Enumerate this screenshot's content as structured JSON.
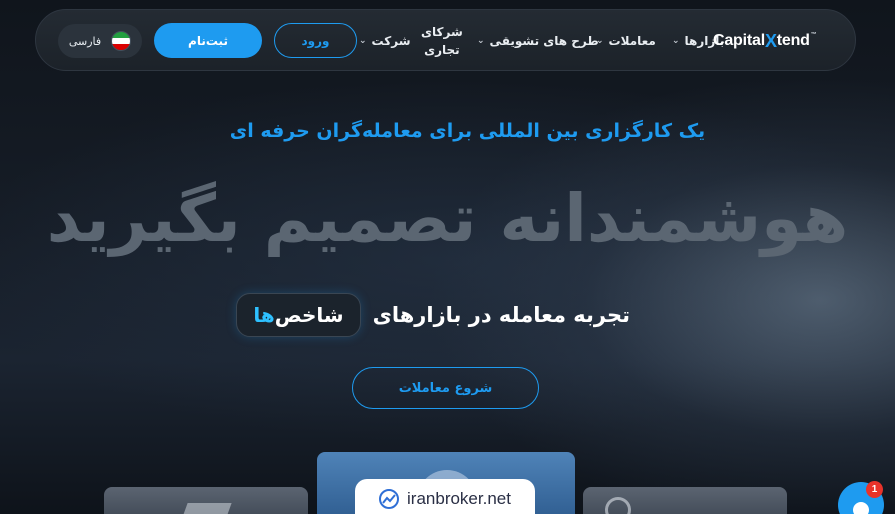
{
  "nav": {
    "logo": {
      "part1": "Capital",
      "x": "X",
      "part2": "tend",
      "tm": "™"
    },
    "items": [
      {
        "label": "بازارها"
      },
      {
        "label": "معاملات"
      },
      {
        "label": "طرح های تشویقی"
      },
      {
        "label": "شرکت"
      },
      {
        "label_line1": "شرکای",
        "label_line2": "تجاری"
      }
    ],
    "login_label": "ورود",
    "signup_label": "ثبت‌نام",
    "language_label": "فارسی",
    "chevron": "⌄"
  },
  "hero": {
    "subtitle": "یک کارگزاری بین المللی برای معامله‌گران حرفه ای",
    "headline": "هوشمندانه تصمیم بگیرید",
    "tagline_text": "تجربه معامله در بازارهای",
    "tagline_chip_plain": "شاخص",
    "tagline_chip_highlight": "‌ها",
    "start_button": "شروع معاملات"
  },
  "watermark": {
    "text": "iranbroker.net"
  },
  "chat": {
    "badge_count": "1"
  },
  "colors": {
    "accent": "#1e9bf0",
    "headline": "#5b6672",
    "badge": "#e8332a",
    "flag": [
      "#239f40",
      "#ffffff",
      "#da0000"
    ]
  }
}
